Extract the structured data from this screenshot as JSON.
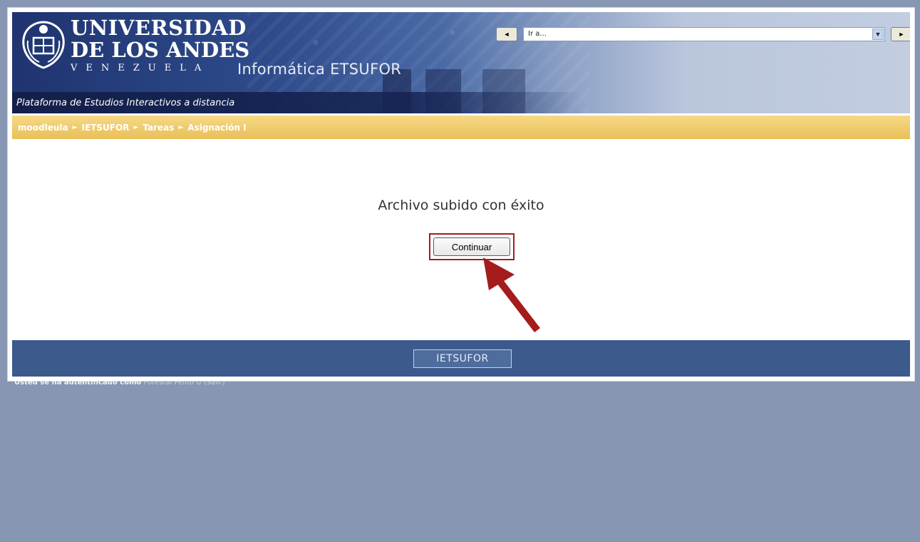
{
  "header": {
    "university_line1": "UNIVERSIDAD",
    "university_line2": "DE LOS ANDES",
    "university_line3": "VENEZUELA",
    "site_name": "Informática ETSUFOR",
    "tagline": "Plataforma de Estudios Interactivos a distancia",
    "seal_icon": "university-seal-icon",
    "jump": {
      "prev_label": "◄",
      "next_label": "►",
      "selected": "Ir a...",
      "dropdown_icon": "chevron-down-icon"
    }
  },
  "breadcrumb": {
    "items": [
      "moodleula",
      "IETSUFOR",
      "Tareas"
    ],
    "current": "Asignación I",
    "separator": "►"
  },
  "main": {
    "message": "Archivo subido con éxito",
    "continue_label": "Continuar",
    "annotation_icon": "red-arrow-pointer-icon"
  },
  "footer": {
    "course_label": "IETSUFOR"
  },
  "login": {
    "prefix": "Usted se ha autentificado como",
    "user": "Forestal Pelito U (Salir)"
  },
  "colors": {
    "background": "#8796b2",
    "breadcrumb": "#e9bf58",
    "footer": "#3c5a8c",
    "highlight": "#a51c1c"
  }
}
